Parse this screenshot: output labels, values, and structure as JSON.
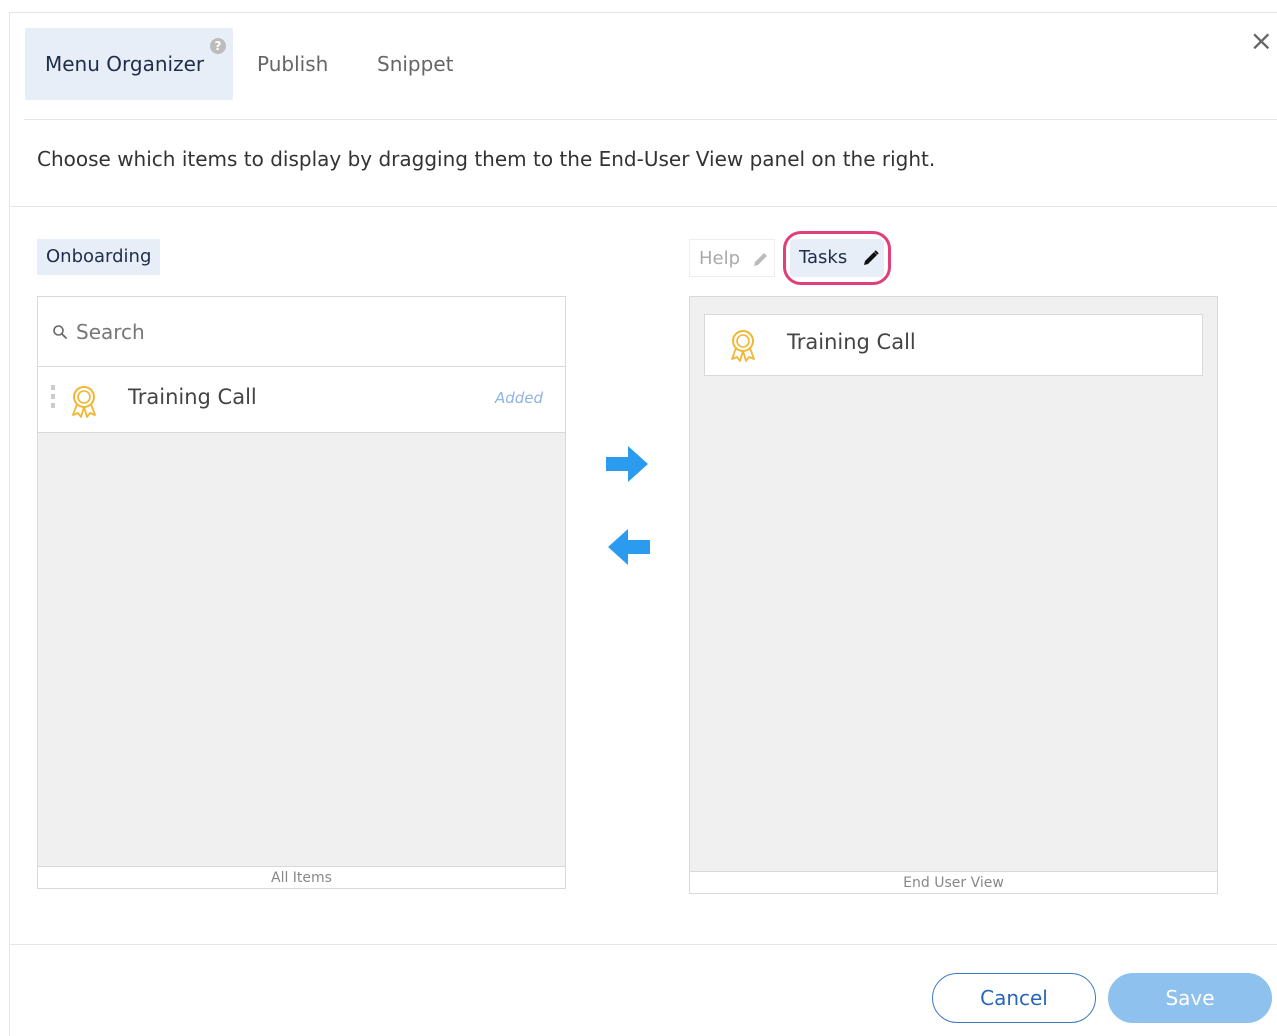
{
  "tabs": [
    {
      "label": "Menu Organizer",
      "active": true
    },
    {
      "label": "Publish",
      "active": false
    },
    {
      "label": "Snippet",
      "active": false
    }
  ],
  "help_badge": "?",
  "close_label": "×",
  "instruction": "Choose which items to display by dragging them to the End-User View panel on the right.",
  "left_panel": {
    "group_label": "Onboarding",
    "search_placeholder": "Search",
    "items": [
      {
        "label": "Training Call",
        "status": "Added",
        "icon": "award-ribbon-icon"
      }
    ],
    "footer": "All Items"
  },
  "right_panel": {
    "view_tabs": [
      {
        "label": "Help",
        "active": false
      },
      {
        "label": "Tasks",
        "active": true
      }
    ],
    "items": [
      {
        "label": "Training Call",
        "icon": "award-ribbon-icon"
      }
    ],
    "footer": "End User View"
  },
  "buttons": {
    "cancel": "Cancel",
    "save": "Save"
  },
  "colors": {
    "accent": "#2b9bf0",
    "tab_active_bg": "#e8eef8",
    "highlight_ring": "#e0407a",
    "award_icon": "#f2b632",
    "save_disabled": "#8ec1ee"
  }
}
